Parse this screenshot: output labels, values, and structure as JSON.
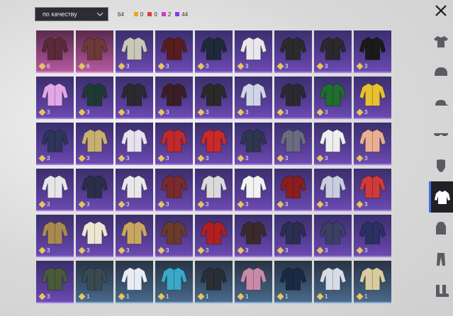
{
  "sort": {
    "label": "по качеству"
  },
  "counts": {
    "total": "64",
    "items": [
      {
        "color": "#e8a622",
        "value": "0"
      },
      {
        "color": "#e0403a",
        "value": "0"
      },
      {
        "color": "#d43bc0",
        "value": "2"
      },
      {
        "color": "#7d3fe0",
        "value": "44"
      }
    ]
  },
  "grid": [
    [
      {
        "q": "pink",
        "n": "6",
        "c": "#5a2a3a"
      },
      {
        "q": "pink",
        "n": "6",
        "c": "#6b3a38"
      },
      {
        "q": "purple",
        "n": "3",
        "c": "#c9c7b8"
      },
      {
        "q": "purple",
        "n": "3",
        "c": "#5a1c1c"
      },
      {
        "q": "purple",
        "n": "3",
        "c": "#1e2a38"
      },
      {
        "q": "purple",
        "n": "3",
        "c": "#e8e8ea"
      },
      {
        "q": "purple",
        "n": "3",
        "c": "#2b2b2b"
      },
      {
        "q": "purple",
        "n": "3",
        "c": "#2a2a2e"
      },
      {
        "q": "purple",
        "n": "3",
        "c": "#1a1a1a"
      }
    ],
    [
      {
        "q": "purple",
        "n": "3",
        "c": "#e2a8e6"
      },
      {
        "q": "purple",
        "n": "3",
        "c": "#1f3a33"
      },
      {
        "q": "purple",
        "n": "3",
        "c": "#2a2a30"
      },
      {
        "q": "purple",
        "n": "3",
        "c": "#3a1e24"
      },
      {
        "q": "purple",
        "n": "3",
        "c": "#2a2a2a"
      },
      {
        "q": "purple",
        "n": "3",
        "c": "#d0d4e8"
      },
      {
        "q": "purple",
        "n": "3",
        "c": "#2a2a30"
      },
      {
        "q": "purple",
        "n": "3",
        "c": "#1e6e2e"
      },
      {
        "q": "purple",
        "n": "3",
        "c": "#e8c030"
      }
    ],
    [
      {
        "q": "purple",
        "n": "3",
        "c": "#2e3558"
      },
      {
        "q": "purple",
        "n": "3",
        "c": "#c8b070"
      },
      {
        "q": "purple",
        "n": "3",
        "c": "#e6e2ee"
      },
      {
        "q": "purple",
        "n": "3",
        "c": "#c02a2a"
      },
      {
        "q": "purple",
        "n": "3",
        "c": "#c82a2a"
      },
      {
        "q": "purple",
        "n": "3",
        "c": "#2e3550"
      },
      {
        "q": "purple",
        "n": "3",
        "c": "#6a6a80"
      },
      {
        "q": "purple",
        "n": "3",
        "c": "#eeeeee"
      },
      {
        "q": "purple",
        "n": "3",
        "c": "#e8b090"
      }
    ],
    [
      {
        "q": "purple",
        "n": "3",
        "c": "#e6e6ea"
      },
      {
        "q": "purple",
        "n": "3",
        "c": "#2a2e48"
      },
      {
        "q": "purple",
        "n": "3",
        "c": "#e8e8e8"
      },
      {
        "q": "purple",
        "n": "3",
        "c": "#7a2a2a"
      },
      {
        "q": "purple",
        "n": "3",
        "c": "#dadada"
      },
      {
        "q": "purple",
        "n": "3",
        "c": "#f2f2f2"
      },
      {
        "q": "purple",
        "n": "3",
        "c": "#8a1e1e"
      },
      {
        "q": "purple",
        "n": "3",
        "c": "#c8cee0"
      },
      {
        "q": "purple",
        "n": "3",
        "c": "#d03a3a"
      }
    ],
    [
      {
        "q": "purple",
        "n": "3",
        "c": "#a88a50"
      },
      {
        "q": "purple",
        "n": "3",
        "c": "#ece6d2"
      },
      {
        "q": "purple",
        "n": "3",
        "c": "#c8a860"
      },
      {
        "q": "purple",
        "n": "3",
        "c": "#6a3a2a"
      },
      {
        "q": "purple",
        "n": "3",
        "c": "#b02020"
      },
      {
        "q": "purple",
        "n": "3",
        "c": "#3a2a2a"
      },
      {
        "q": "purple",
        "n": "3",
        "c": "#2a2e50"
      },
      {
        "q": "purple",
        "n": "3",
        "c": "#3a4064"
      },
      {
        "q": "purple",
        "n": "3",
        "c": "#2a3060"
      }
    ],
    [
      {
        "q": "purple",
        "n": "3",
        "c": "#4a5a3a"
      },
      {
        "q": "blue",
        "n": "1",
        "c": "#3a4a52"
      },
      {
        "q": "blue",
        "n": "1",
        "c": "#e8ecf4"
      },
      {
        "q": "blue",
        "n": "1",
        "c": "#3aa8c8"
      },
      {
        "q": "blue",
        "n": "1",
        "c": "#2a2e36"
      },
      {
        "q": "blue",
        "n": "1",
        "c": "#c88aa8"
      },
      {
        "q": "blue",
        "n": "1",
        "c": "#1a2a44"
      },
      {
        "q": "blue",
        "n": "1",
        "c": "#d8dce6"
      },
      {
        "q": "blue",
        "n": "1",
        "c": "#d8cca0"
      }
    ]
  ],
  "sidebar": [
    {
      "name": "shirt-category-icon",
      "active": false
    },
    {
      "name": "helmet-category-icon",
      "active": false
    },
    {
      "name": "cap-category-icon",
      "active": false
    },
    {
      "name": "glasses-category-icon",
      "active": false
    },
    {
      "name": "mask-category-icon",
      "active": false
    },
    {
      "name": "jacket-category-icon",
      "active": true
    },
    {
      "name": "backpack-category-icon",
      "active": false
    },
    {
      "name": "pants-category-icon",
      "active": false
    },
    {
      "name": "boots-category-icon",
      "active": false
    }
  ]
}
